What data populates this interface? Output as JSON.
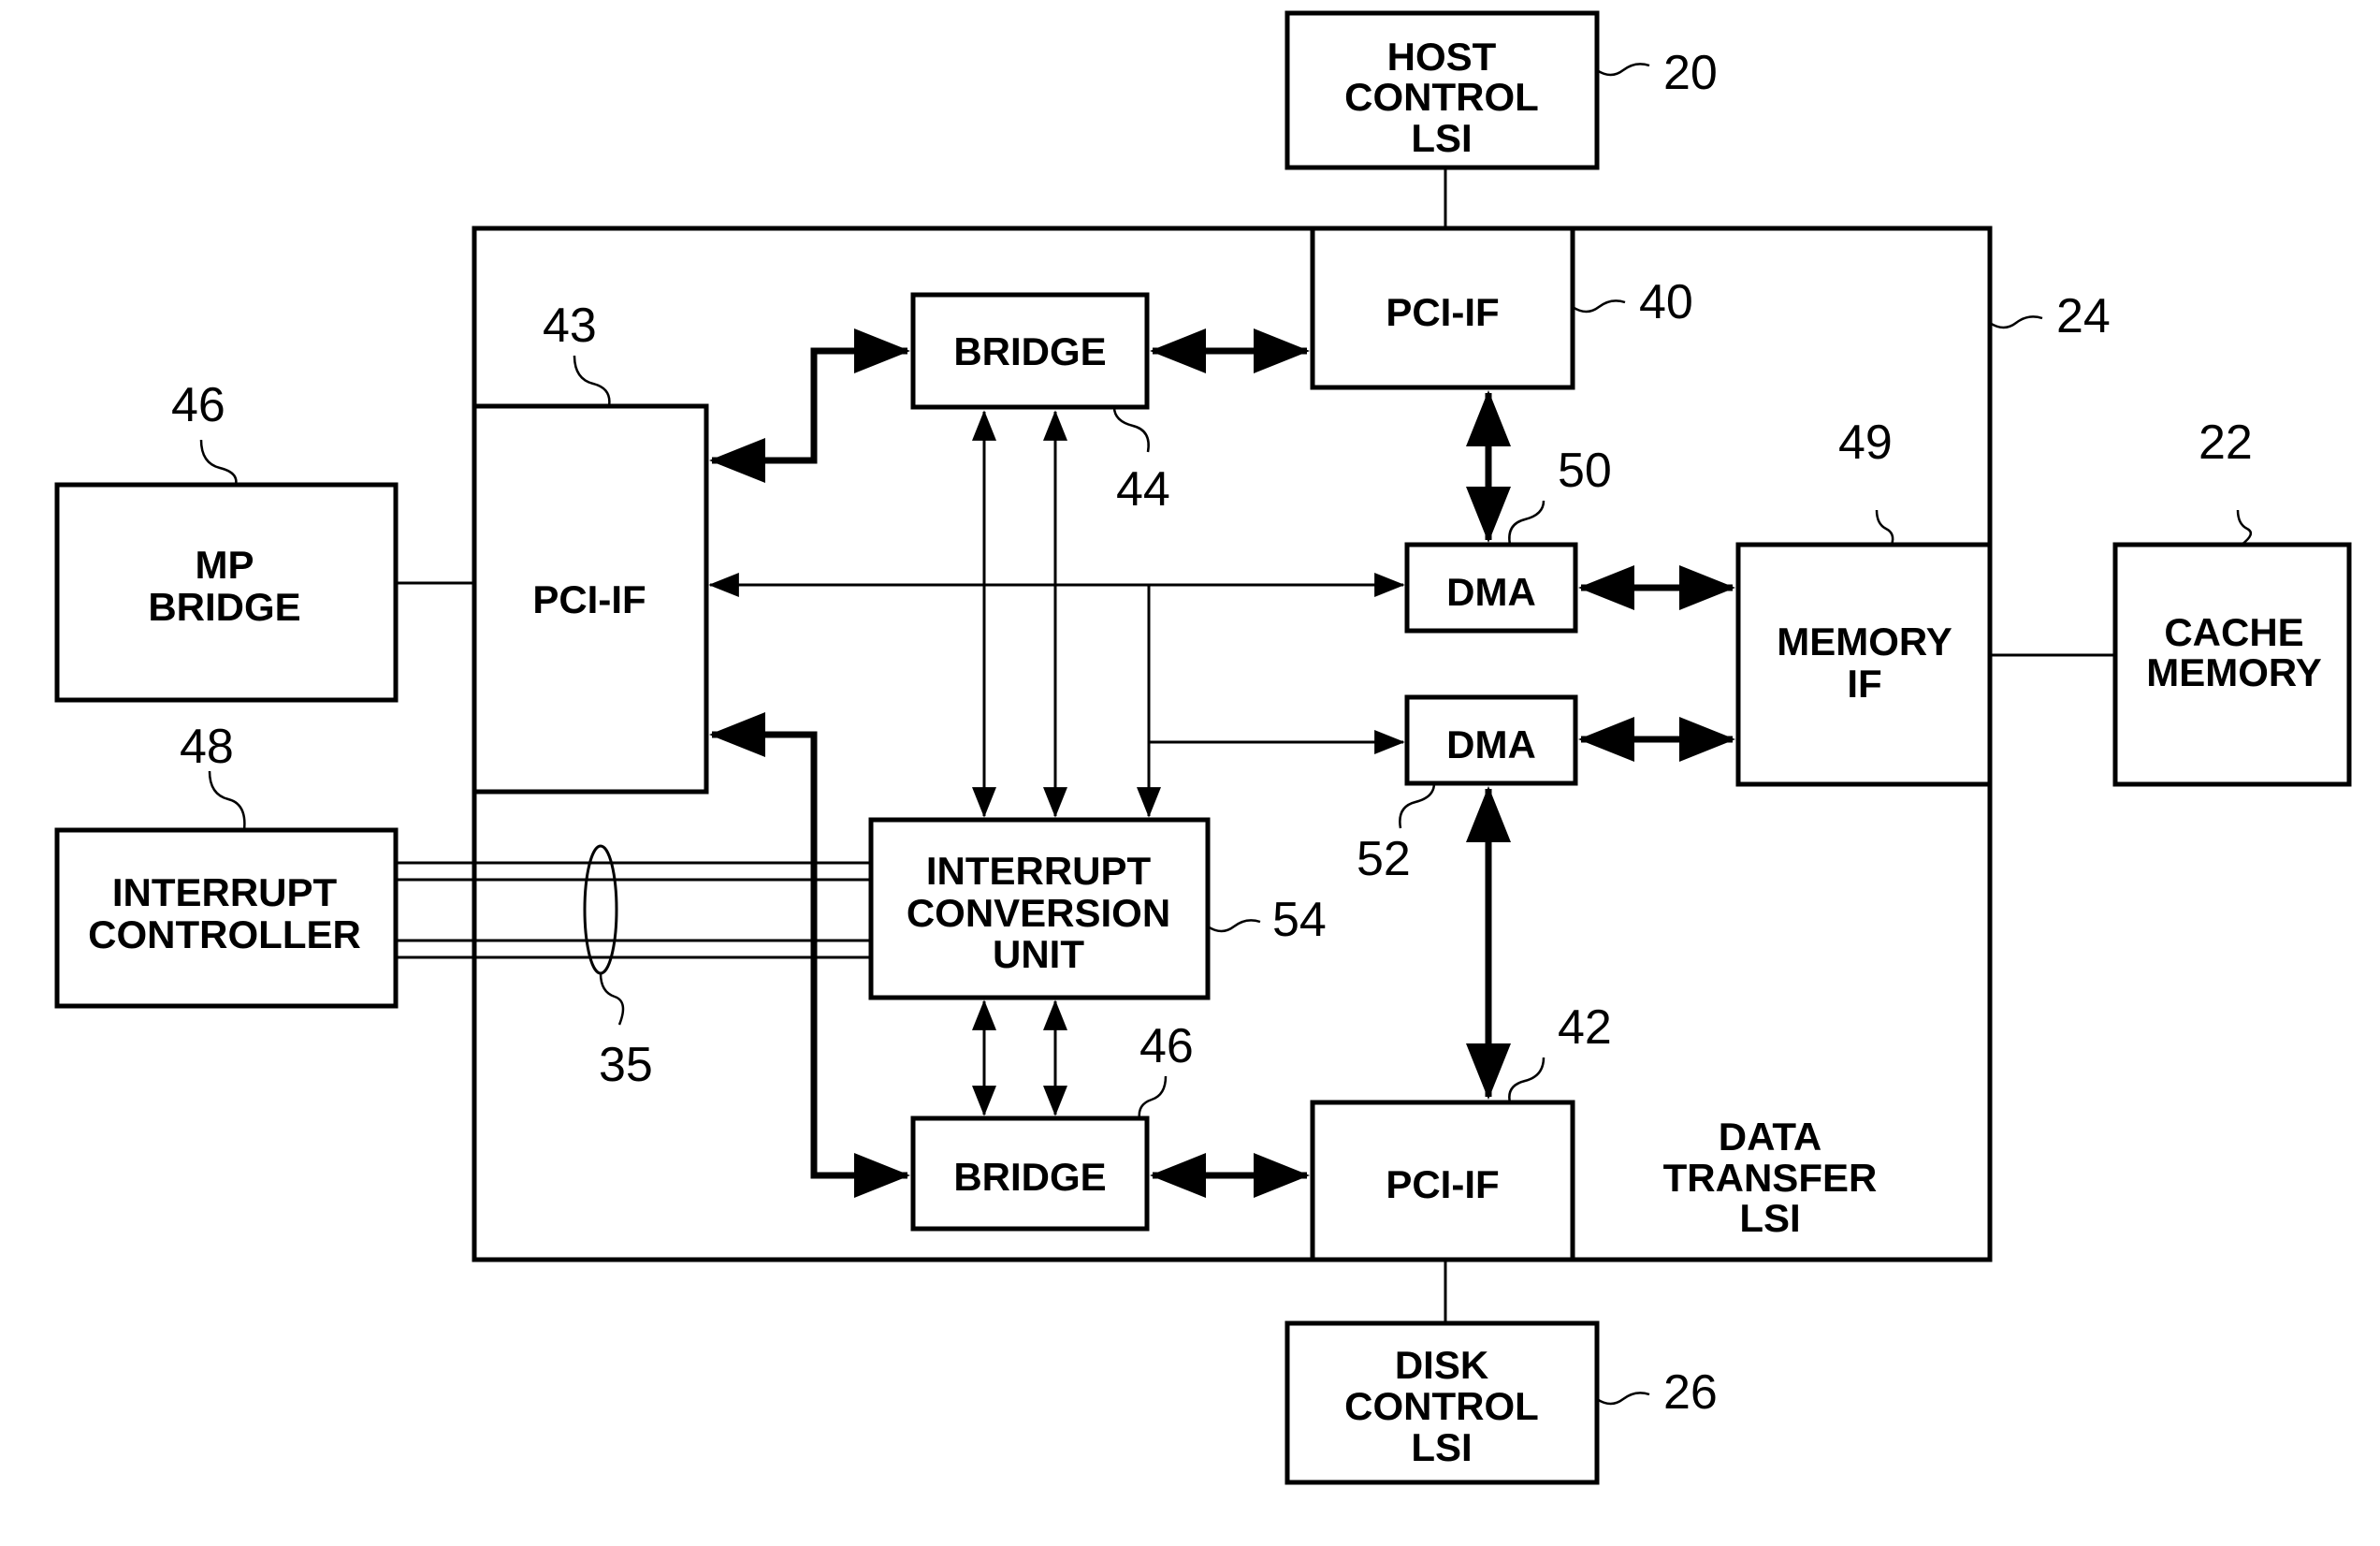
{
  "blocks": {
    "host_control": [
      "HOST",
      "CONTROL",
      "LSI"
    ],
    "pci_if_top": [
      "PCI-IF"
    ],
    "pci_if_left": [
      "PCI-IF"
    ],
    "pci_if_bottom": [
      "PCI-IF"
    ],
    "bridge_top": [
      "BRIDGE"
    ],
    "bridge_bottom": [
      "BRIDGE"
    ],
    "mp_bridge": [
      "MP",
      "BRIDGE"
    ],
    "interrupt_controller": [
      "INTERRUPT",
      "CONTROLLER"
    ],
    "interrupt_conversion": [
      "INTERRUPT",
      "CONVERSION",
      "UNIT"
    ],
    "dma_top": [
      "DMA"
    ],
    "dma_bottom": [
      "DMA"
    ],
    "memory_if": [
      "MEMORY",
      "IF"
    ],
    "cache_memory": [
      "CACHE",
      "MEMORY"
    ],
    "disk_control": [
      "DISK",
      "CONTROL",
      "LSI"
    ],
    "data_transfer": [
      "DATA",
      "TRANSFER",
      "LSI"
    ]
  },
  "refs": {
    "host_control": "20",
    "pci_if_top": "40",
    "data_transfer": "24",
    "pci_if_left": "43",
    "mp_bridge": "46",
    "bridge_top": "44",
    "dma_top": "50",
    "memory_if": "49",
    "cache_memory": "22",
    "interrupt_controller": "48",
    "dma_bottom": "52",
    "interrupt_conversion": "54",
    "signal_bundle": "35",
    "bridge_bottom": "46",
    "pci_if_bottom": "42",
    "disk_control": "26"
  }
}
